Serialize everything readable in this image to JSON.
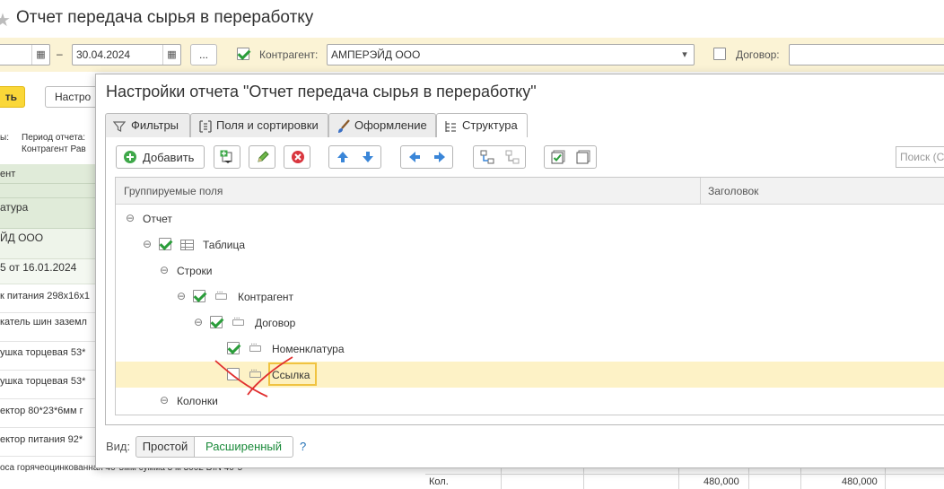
{
  "background": {
    "title": "Отчет передача сырья в переработку",
    "filter": {
      "date_to": "30.04.2024",
      "dash": "–",
      "ellipsis": "...",
      "counterparty_label": "Контрагент:",
      "counterparty_value": "АМПЕРЭЙД ООО",
      "contract_label": "Договор:"
    },
    "generate_button": "ть",
    "settings_button": "Настро",
    "report_header": {
      "label1": "ы:",
      "label2": "Период отчета:",
      "label3": "Контрагент Рав"
    },
    "left_rows": [
      "ент",
      "атура",
      "ЙД ООО",
      "5 от 16.01.2024",
      "к питания 298x16x1",
      "катель шин заземл",
      "ушка торцевая 53*",
      "ушка торцевая 53*",
      "ектор 80*23*6мм г",
      "ектор питания 92*",
      "оса горячеоцинкованная 40*5мм сумма 3 м 3002 DIN 40*5"
    ],
    "bottom_rows": [
      {
        "label": "Кол.",
        "value1": "480,000",
        "value2": "480,000"
      }
    ]
  },
  "dialog": {
    "title": "Настройки отчета \"Отчет передача сырья в переработку\"",
    "tabs": [
      {
        "label": "Фильтры",
        "icon": "filter-icon"
      },
      {
        "label": "Поля и сортировки",
        "icon": "fields-icon"
      },
      {
        "label": "Оформление",
        "icon": "brush-icon"
      },
      {
        "label": "Структура",
        "icon": "structure-icon"
      }
    ],
    "toolbar": {
      "add_label": "Добавить",
      "search_placeholder": "Поиск (С"
    },
    "grid": {
      "col_fields": "Группируемые поля",
      "col_header": "Заголовок"
    },
    "tree": [
      {
        "label": "Отчет"
      },
      {
        "label": "Таблица"
      },
      {
        "label": "Строки"
      },
      {
        "label": "Контрагент"
      },
      {
        "label": "Договор"
      },
      {
        "label": "Номенклатура"
      },
      {
        "label": "Ссылка"
      },
      {
        "label": "Колонки"
      }
    ],
    "view": {
      "label": "Вид:",
      "simple": "Простой",
      "extended": "Расширенный",
      "help": "?"
    }
  }
}
